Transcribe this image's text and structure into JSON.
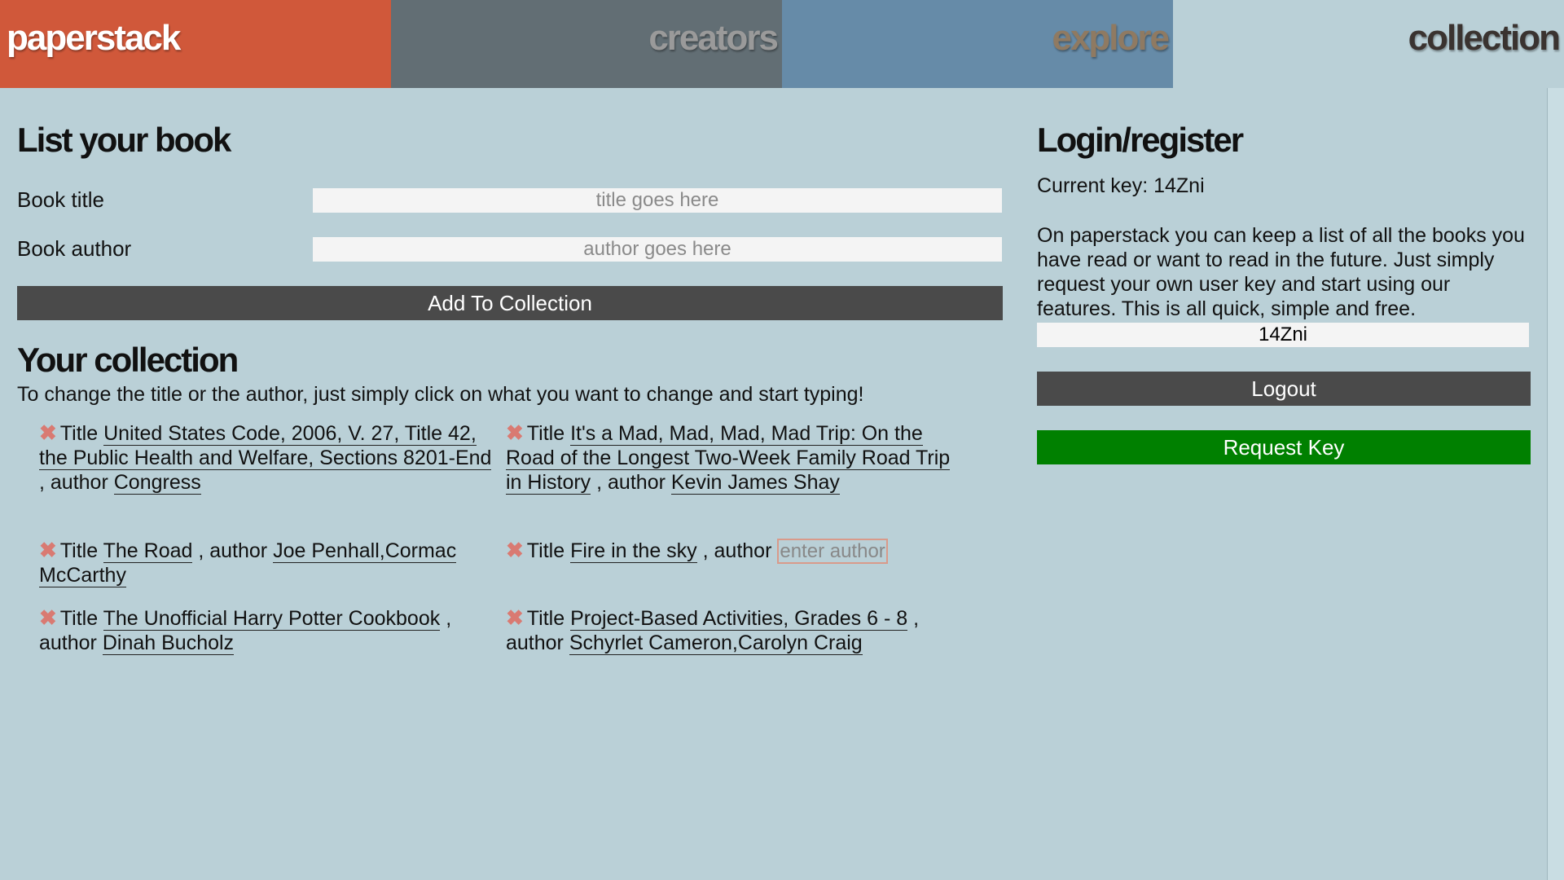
{
  "nav": {
    "brand": "paperstack",
    "creators": "creators",
    "explore": "explore",
    "collection": "collection"
  },
  "list_book": {
    "title": "List your book",
    "title_label": "Book title",
    "title_placeholder": "title goes here",
    "author_label": "Book author",
    "author_placeholder": "author goes here",
    "add_button": "Add To Collection"
  },
  "collection": {
    "title": "Your collection",
    "hint": "To change the title or the author, just simply click on what you want to change and start typing!",
    "title_prefix": "Title",
    "author_prefix": ", author",
    "delete_icon": "✖",
    "empty_author_placeholder": "enter author",
    "books": [
      {
        "title": "United States Code, 2006, V. 27, Title 42, the Public Health and Welfare, Sections 8201-End",
        "author": "Congress"
      },
      {
        "title": "It's a Mad, Mad, Mad, Mad Trip: On the Road of the Longest Two-Week Family Road Trip in History",
        "author": "Kevin James Shay"
      },
      {
        "title": "The Road",
        "author": "Joe Penhall,Cormac McCarthy"
      },
      {
        "title": "Fire in the sky",
        "author": ""
      },
      {
        "title": "The Unofficial Harry Potter Cookbook",
        "author": "Dinah Bucholz"
      },
      {
        "title": "Project-Based Activities, Grades 6 - 8",
        "author": "Schyrlet Cameron,Carolyn Craig"
      }
    ]
  },
  "login": {
    "title": "Login/register",
    "current_key": "Current key: 14Zni",
    "about": "On paperstack you can keep a list of all the books you have read or want to read in the future. Just simply request your own user key and start using our features. This is all quick, simple and free.",
    "key_value": "14Zni",
    "logout_button": "Logout",
    "request_button": "Request Key"
  },
  "colors": {
    "brand": "#d0583a",
    "background": "#bad0d7",
    "button_dark": "#4a4a4a",
    "button_green": "#008000",
    "delete": "#d97a72"
  }
}
